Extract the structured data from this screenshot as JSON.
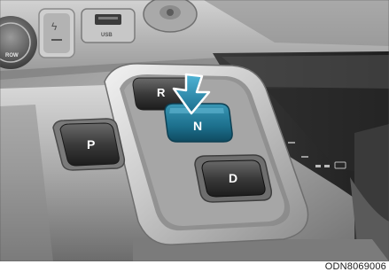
{
  "console": {
    "usb_label": "USB",
    "power_symbol": "ϟ",
    "side_label": "ROW"
  },
  "shifter": {
    "button_r": "R",
    "button_n": "N",
    "button_p": "P",
    "button_d": "D",
    "highlighted_button": "N",
    "arrow_color": "#1f7fa0",
    "highlight_color": "#1c6f8c"
  },
  "caption": {
    "figure_code": "ODN8069006"
  }
}
